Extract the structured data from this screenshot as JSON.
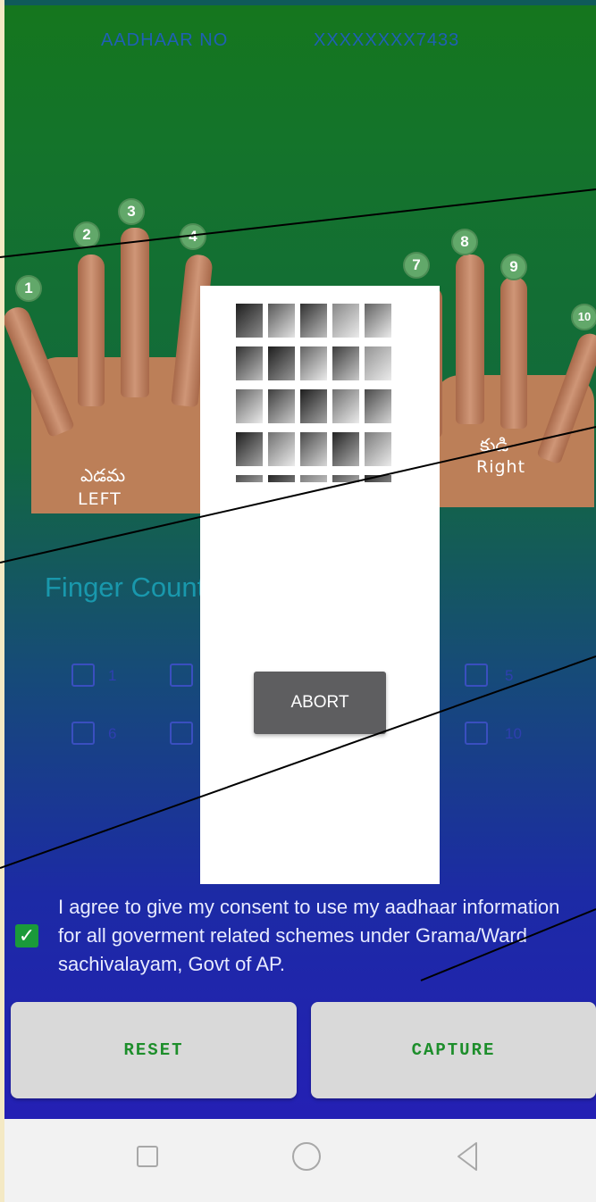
{
  "header": {
    "aadhaar_label": "AADHAAR NO",
    "aadhaar_value": "XXXXXXXX7433"
  },
  "hands": {
    "left": {
      "label_te": "ఎడమ",
      "label_en": "LEFT",
      "finger_numbers": [
        "1",
        "2",
        "3",
        "4"
      ]
    },
    "right": {
      "label_te": "కుడి",
      "label_en": "Right",
      "finger_numbers": [
        "7",
        "8",
        "9",
        "10"
      ]
    }
  },
  "finger_count": {
    "label": "Finger Count",
    "options": [
      "1",
      "5",
      "6",
      "10"
    ]
  },
  "consent": {
    "checked": true,
    "text": "I agree to give my consent to use my aadhaar information for all goverment related schemes under Grama/Ward sachivalayam, Govt of AP."
  },
  "buttons": {
    "reset": "RESET",
    "capture": "CAPTURE"
  },
  "dialog": {
    "abort": "ABORT"
  },
  "icons": {
    "consent_check": "check-icon",
    "nav_recent": "square-icon",
    "nav_home": "circle-icon",
    "nav_back": "triangle-back-icon"
  },
  "colors": {
    "accent_green": "#1d8e2b",
    "consent_text": "#e8ebff"
  }
}
